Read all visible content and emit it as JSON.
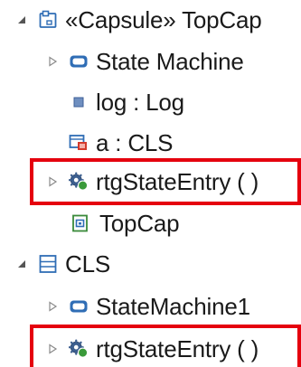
{
  "tree": {
    "items": [
      {
        "label": "«Capsule» TopCap",
        "expanded": true,
        "icon": "capsule-icon"
      },
      {
        "label": "State Machine",
        "expanded": false,
        "icon": "state-machine-icon"
      },
      {
        "label": "log : Log",
        "icon": "attribute-icon"
      },
      {
        "label": "a : CLS",
        "icon": "part-icon"
      },
      {
        "label": "rtgStateEntry ( )",
        "expanded": false,
        "icon": "operation-icon",
        "highlighted": true
      },
      {
        "label": "TopCap",
        "icon": "diagram-icon"
      },
      {
        "label": "CLS",
        "expanded": true,
        "icon": "class-icon"
      },
      {
        "label": "StateMachine1",
        "expanded": false,
        "icon": "state-machine-icon"
      },
      {
        "label": "rtgStateEntry ( )",
        "expanded": false,
        "icon": "operation-icon",
        "highlighted": true
      }
    ]
  },
  "colors": {
    "highlight": "#e5000e",
    "expander": "#7a7a7a",
    "icon_blue": "#2f6db5",
    "icon_green": "#3a9a3a",
    "icon_red": "#d33a2c"
  }
}
